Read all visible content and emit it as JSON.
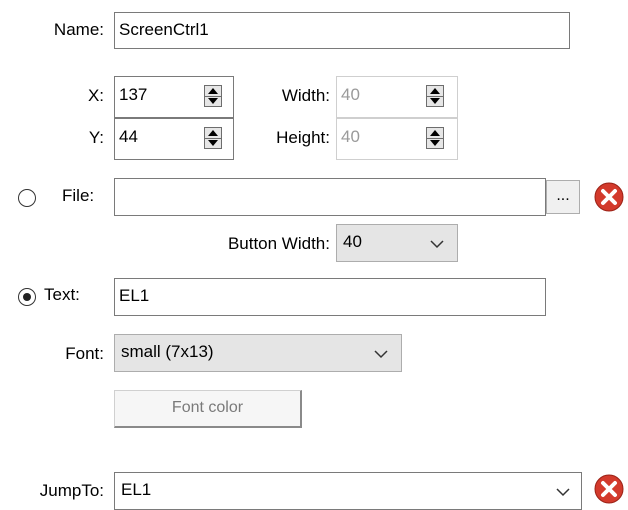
{
  "name": {
    "label": "Name:",
    "value": "ScreenCtrl1"
  },
  "position": {
    "x_label": "X:",
    "x_value": "137",
    "y_label": "Y:",
    "y_value": "44",
    "width_label": "Width:",
    "width_value": "40",
    "height_label": "Height:",
    "height_value": "40"
  },
  "file": {
    "label": "File:",
    "value": "",
    "browse_label": "...",
    "selected": false
  },
  "button_width": {
    "label": "Button Width:",
    "value": "40"
  },
  "text": {
    "label": "Text:",
    "value": "EL1",
    "selected": true
  },
  "font": {
    "label": "Font:",
    "value": "small (7x13)"
  },
  "font_color": {
    "label": "Font color"
  },
  "jumpto": {
    "label": "JumpTo:",
    "value": "EL1"
  },
  "icons": {
    "clear": "clear-red-x-icon",
    "dropdown": "chevron-down-icon"
  },
  "colors": {
    "clear_red": "#d33a2c",
    "disabled_text": "#9a9a9a",
    "border": "#7a7a7a"
  }
}
